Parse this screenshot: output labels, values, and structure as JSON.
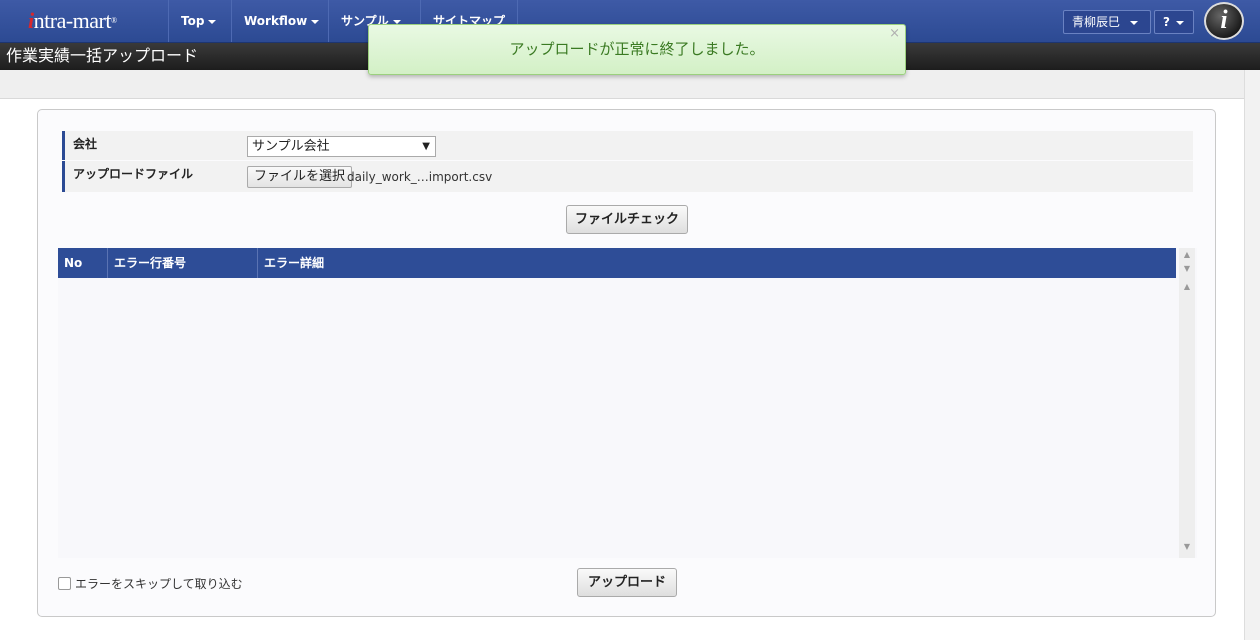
{
  "brand": {
    "logo_text": "intra-mart"
  },
  "nav": {
    "items": [
      {
        "label": "Top"
      },
      {
        "label": "Workflow"
      },
      {
        "label": "サンプル"
      },
      {
        "label": "サイトマップ"
      }
    ],
    "user_name": "青柳辰巳",
    "help_label": "?",
    "avatar_letter": "i"
  },
  "page": {
    "title": "作業実績一括アップロード"
  },
  "toast": {
    "message": "アップロードが正常に終了しました。",
    "close": "×"
  },
  "form": {
    "company_label": "会社",
    "company_value": "サンプル会社",
    "upload_label": "アップロードファイル",
    "file_button": "ファイルを選択",
    "file_name": "daily_work_…import.csv"
  },
  "actions": {
    "check_button": "ファイルチェック",
    "upload_button": "アップロード",
    "skip_label": "エラーをスキップして取り込む",
    "skip_checked": false
  },
  "grid": {
    "columns": [
      "No",
      "エラー行番号",
      "エラー詳細"
    ],
    "rows": []
  },
  "colors": {
    "nav": "#2c4a93",
    "grid_header": "#2e4d97",
    "toast_bg": "#d3f0c6",
    "toast_text": "#3a7a22"
  }
}
